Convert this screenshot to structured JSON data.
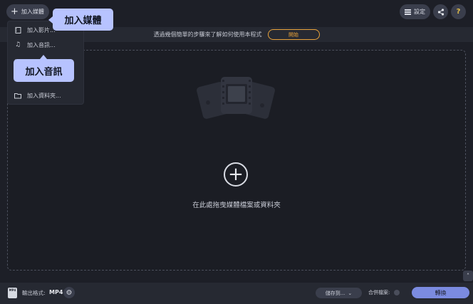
{
  "topbar": {
    "add_media_label": "加入媒體",
    "settings_label": "設定",
    "help_label": "?"
  },
  "promo": {
    "text": "透過幾個簡單的步驟來了解如何使用本程式",
    "button_label": "開始"
  },
  "menu": {
    "items": [
      {
        "label": "加入影片..."
      },
      {
        "label": "加入音訊..."
      },
      {
        "label": "加入資料夾..."
      }
    ]
  },
  "tooltips": {
    "add_media": "加入媒體",
    "add_audio": "加入音訊"
  },
  "drop_area": {
    "text": "在此處拖曳媒體檔案或資料夾"
  },
  "bottom": {
    "format_icon_text": "MP4",
    "format_label": "輸出格式:",
    "format_value": "MP4",
    "save_to_label": "儲存到...",
    "merge_label": "合併檔案:",
    "convert_label": "轉換"
  },
  "colors": {
    "background": "#1d1f27",
    "panel": "#262932",
    "accent": "#7b8be0",
    "tooltip": "#b7c3ff",
    "promo_button": "#e8a23a"
  }
}
